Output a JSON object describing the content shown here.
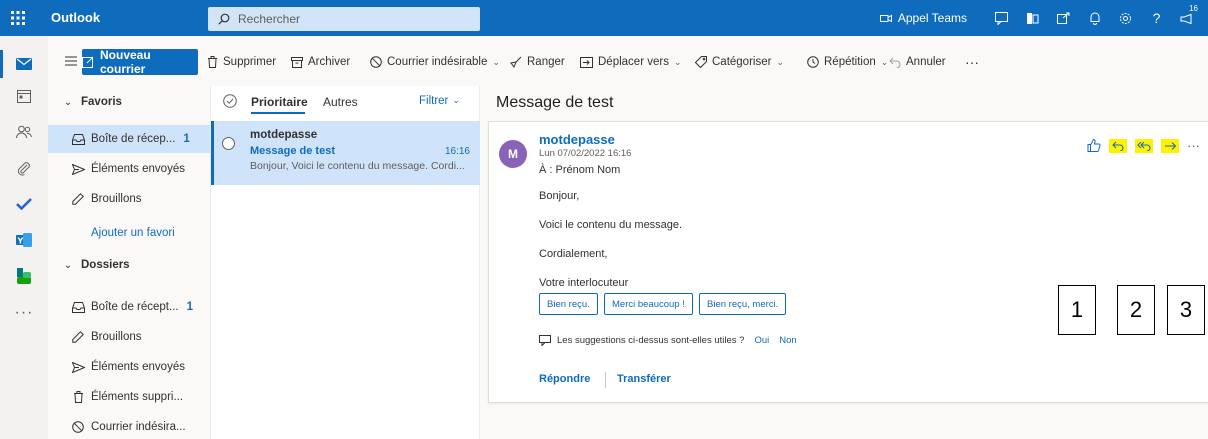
{
  "topbar": {
    "app_name": "Outlook",
    "search_placeholder": "Rechercher",
    "teams_label": "Appel Teams",
    "notif_badge": "16"
  },
  "commands": {
    "new_mail": "Nouveau courrier",
    "delete": "Supprimer",
    "archive": "Archiver",
    "junk": "Courrier indésirable",
    "sweep": "Ranger",
    "move_to": "Déplacer vers",
    "categorize": "Catégoriser",
    "snooze": "Répétition",
    "undo": "Annuler",
    "more": "···"
  },
  "folders": {
    "favorites_header": "Favoris",
    "favorites": [
      {
        "label": "Boîte de récep...",
        "count": "1",
        "icon": "inbox-icon"
      },
      {
        "label": "Éléments envoyés",
        "count": "",
        "icon": "send-icon"
      },
      {
        "label": "Brouillons",
        "count": "",
        "icon": "pencil-icon"
      }
    ],
    "add_favorite": "Ajouter un favori",
    "folders_header": "Dossiers",
    "items": [
      {
        "label": "Boîte de récept...",
        "count": "1",
        "icon": "inbox-icon"
      },
      {
        "label": "Brouillons",
        "count": "",
        "icon": "pencil-icon"
      },
      {
        "label": "Éléments envoyés",
        "count": "",
        "icon": "send-icon"
      },
      {
        "label": "Éléments suppri...",
        "count": "",
        "icon": "trash-icon"
      },
      {
        "label": "Courrier indésira...",
        "count": "",
        "icon": "blocked-icon"
      }
    ]
  },
  "message_list": {
    "tab_focused": "Prioritaire",
    "tab_other": "Autres",
    "filter": "Filtrer",
    "messages": [
      {
        "sender": "motdepasse",
        "subject": "Message de test",
        "time": "16:16",
        "preview": "Bonjour, Voici le contenu du message. Cordi..."
      }
    ]
  },
  "reading": {
    "subject": "Message de test",
    "avatar_initial": "M",
    "sender": "motdepasse",
    "date": "Lun 07/02/2022 16:16",
    "to": "À : Prénom Nom",
    "body": [
      "Bonjour,",
      "Voici le contenu du message.",
      "Cordialement,",
      "Votre interlocuteur"
    ],
    "suggestions": [
      "Bien reçu.",
      "Merci beaucoup !",
      "Bien reçu, merci."
    ],
    "useful_question": "Les suggestions ci-dessus sont-elles utiles ?",
    "yes": "Oui",
    "no": "Non",
    "reply": "Répondre",
    "forward": "Transférer",
    "more": "···"
  },
  "annotations": [
    "1",
    "2",
    "3"
  ],
  "colors": {
    "brand": "#0f6cbd",
    "highlight": "#fff200",
    "avatar": "#8764b8",
    "selection": "#cfe4fa"
  }
}
